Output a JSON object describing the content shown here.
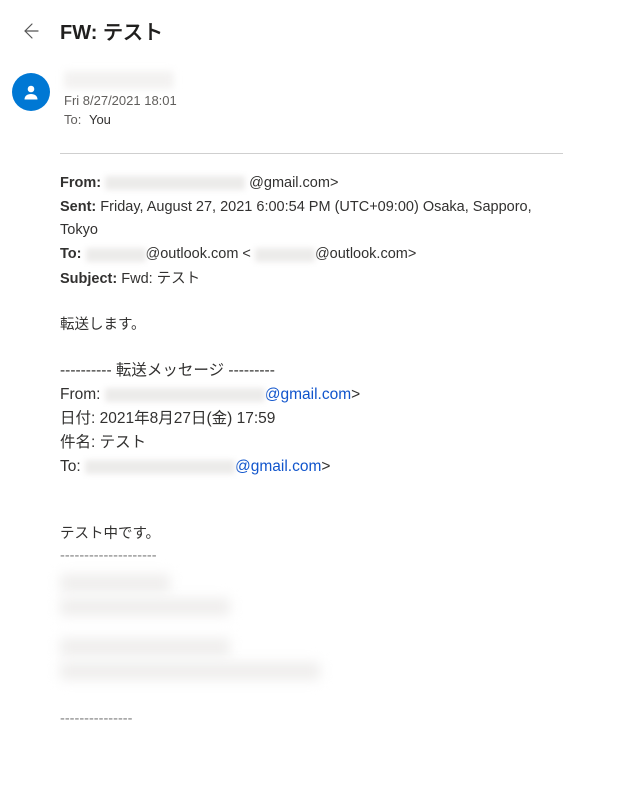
{
  "header": {
    "subject": "FW: テスト"
  },
  "meta": {
    "timestamp": "Fri 8/27/2021 18:01",
    "to_label": "To:",
    "to_value": "You"
  },
  "outer_headers": {
    "from_label": "From:",
    "from_domain": "@gmail.com>",
    "sent_label": "Sent:",
    "sent_value": "Friday, August 27, 2021 6:00:54 PM (UTC+09:00) Osaka, Sapporo, Tokyo",
    "to_label": "To:",
    "to_domain1": "@outlook.com <",
    "to_domain2": "@outlook.com>",
    "subject_label": "Subject:",
    "subject_value": "Fwd: テスト"
  },
  "body": {
    "line1": "転送します。",
    "fwd_separator": "---------- 転送メッセージ ---------",
    "from_label": "From:",
    "from_domain": "@gmail.com",
    "from_suffix": ">",
    "date_label": "日付:",
    "date_value": "2021年8月27日(金) 17:59",
    "subj_label": "件名:",
    "subj_value": "テスト",
    "to_label": "To:",
    "to_domain": "@gmail.com",
    "to_suffix": ">",
    "test_line": "テスト中です。",
    "dash1": "--------------------",
    "dash2": "---------------"
  }
}
